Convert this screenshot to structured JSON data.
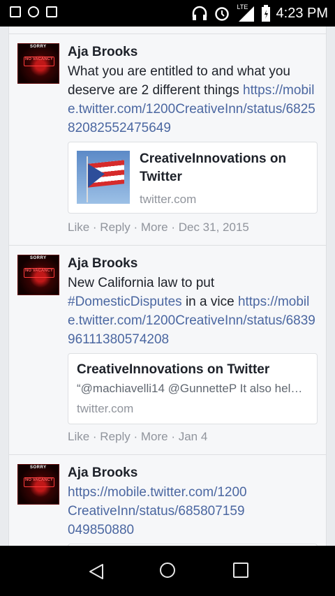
{
  "status_bar": {
    "time": "4:23 PM",
    "network_label": "LTE"
  },
  "avatar": {
    "sorry": "SORRY",
    "sign": "NO VACANCY"
  },
  "posts": [
    {
      "author": "Aja Brooks",
      "text": "What you are entitled to and what you deserve are 2 different things ",
      "link": "https://mobile.twitter.com/1200CreativeInn/status/682582082552475649",
      "card": {
        "title": "CreativeInnovations on Twitter",
        "domain": "twitter.com"
      },
      "actions": {
        "like": "Like",
        "reply": "Reply",
        "more": "More",
        "date": "Dec 31, 2015"
      }
    },
    {
      "author": "Aja Brooks",
      "text_before": "New California law to put ",
      "hashtag": "#DomesticDisputes",
      "text_after": " in a vice ",
      "link": "https://mobile.twitter.com/1200CreativeInn/status/683996111380574208",
      "card": {
        "title": "CreativeInnovations on Twitter",
        "description": "“@machiavelli14 @GunnetteP It also hel…",
        "domain": "twitter.com"
      },
      "actions": {
        "like": "Like",
        "reply": "Reply",
        "more": "More",
        "date": "Jan 4"
      }
    },
    {
      "author": "Aja Brooks",
      "link": "https://mobile.twitter.com/1200CreativeInn/status/685807159049850880"
    }
  ],
  "action_separator": " · "
}
